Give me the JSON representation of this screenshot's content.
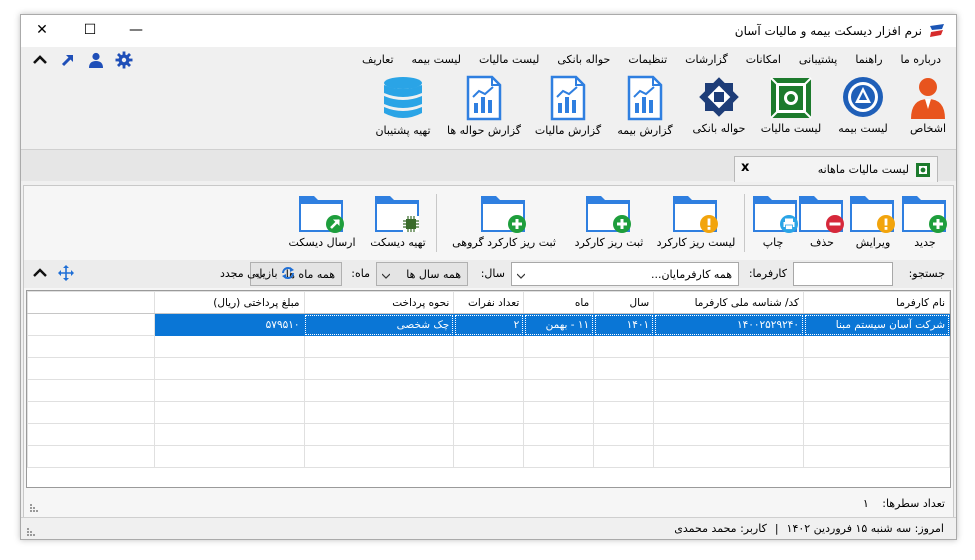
{
  "window": {
    "title": "نرم افزار دیسکت بیمه و مالیات آسان",
    "minimize": "—",
    "maximize": "☐",
    "close": "✕"
  },
  "menu": [
    "تعاریف",
    "لیست بیمه",
    "لیست مالیات",
    "حواله بانکی",
    "تنظیمات",
    "گزارشات",
    "امکانات",
    "پشتیبانی",
    "راهنما",
    "درباره ما"
  ],
  "ribbon": [
    {
      "label": "اشخاص",
      "icon": "person-icon"
    },
    {
      "label": "لیست بیمه",
      "icon": "insurance-logo-icon"
    },
    {
      "label": "لیست مالیات",
      "icon": "tax-logo-icon"
    },
    {
      "label": "حواله بانکی",
      "icon": "bank-logo-icon"
    },
    {
      "label": "گزارش بیمه",
      "icon": "report-chart-icon"
    },
    {
      "label": "گزارش مالیات",
      "icon": "report-chart-icon"
    },
    {
      "label": "گزارش حواله ها",
      "icon": "report-chart-icon"
    },
    {
      "label": "تهیه پشتیبان",
      "icon": "database-icon"
    }
  ],
  "tab": {
    "label": "لیست مالیات ماهانه",
    "close": "x"
  },
  "toolbar": [
    {
      "label": "جدید",
      "badge": "plus"
    },
    {
      "label": "ویرایش",
      "badge": "warning"
    },
    {
      "label": "حذف",
      "badge": "minus"
    },
    {
      "label": "چاپ",
      "badge": "printer"
    },
    {
      "label": "لیست ریز کارکرد",
      "badge": "warning"
    },
    {
      "label": "ثبت ریز کارکرد",
      "badge": "plus"
    },
    {
      "label": "ثبت ریز کارکرد گروهی",
      "badge": "plus"
    },
    {
      "label": "تهیه دیسکت",
      "badge": "chip"
    },
    {
      "label": "ارسال دیسکت",
      "badge": "send"
    }
  ],
  "filters": {
    "search_label": "جستجو:",
    "search_value": "",
    "employer_label": "کارفرما:",
    "employer_value": "همه کارفرمایان...",
    "year_label": "سال:",
    "year_value": "همه سال ها",
    "month_label": "ماه:",
    "month_value": "همه ماه ها",
    "refresh_label": "بازیابی مجدد"
  },
  "grid": {
    "columns": [
      "نام کارفرما",
      "کد/ شناسه ملی کارفرما",
      "سال",
      "ماه",
      "تعداد نفرات",
      "نحوه پرداخت",
      "مبلغ پرداختی (ریال)"
    ],
    "rows": [
      [
        "شرکت آسان سیستم مبنا",
        "۱۴۰۰۲۵۲۹۲۴۰",
        "۱۴۰۱",
        "۱۱ - بهمن",
        "۲",
        "چک شخصی",
        "۵۷۹۵۱۰"
      ]
    ]
  },
  "rowcount": {
    "label": "تعداد سطرها:",
    "value": "۱"
  },
  "status": {
    "today": "امروز: سه شنبه ۱۵ فروردین ۱۴۰۲",
    "separator": "|",
    "user": "کاربر: محمد محمدی"
  },
  "colors": {
    "accent": "#0a76d6",
    "folder": "#2f7fe0",
    "green": "#1e9e3c",
    "red": "#d6283a",
    "orange": "#f2a40c"
  }
}
